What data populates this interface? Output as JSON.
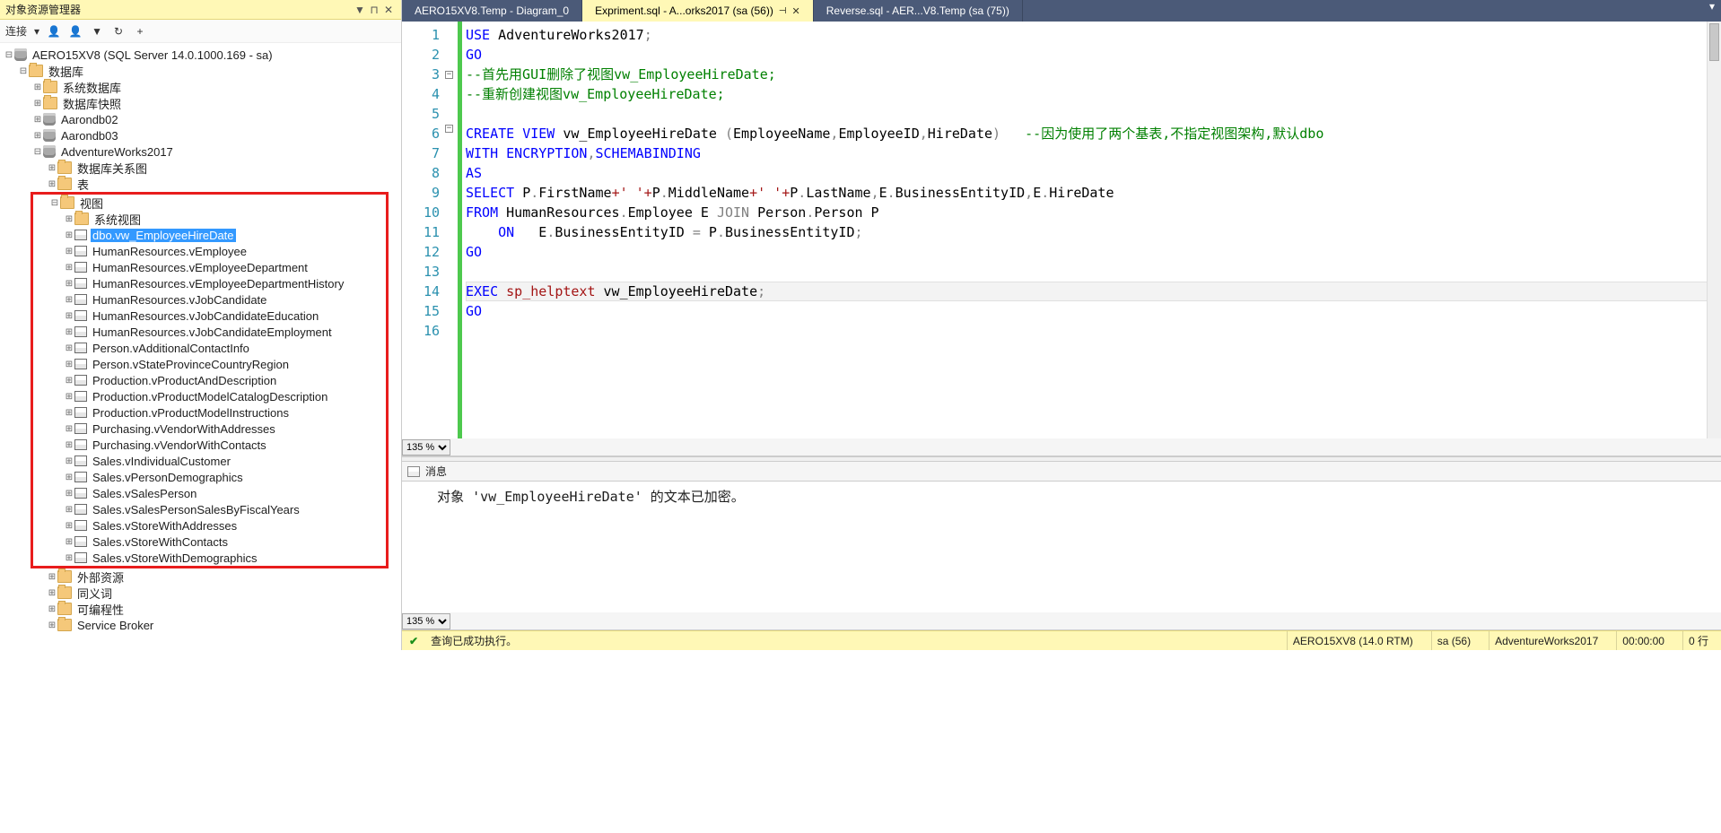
{
  "panel": {
    "title": "对象资源管理器",
    "connect_label": "连接",
    "dropdown_icon": "▼",
    "pin_icon": "⊓",
    "close_icon": "✕"
  },
  "toolbar_icons": {
    "connect_person": "👤",
    "disconnect_person": "👤",
    "filter": "▼",
    "refresh": "↻",
    "plus": "+"
  },
  "tree": {
    "root": "AERO15XV8 (SQL Server 14.0.1000.169 - sa)",
    "databases": "数据库",
    "sys_dbs": "系统数据库",
    "db_snapshots": "数据库快照",
    "db1": "Aarondb02",
    "db2": "Aarondb03",
    "adv": "AdventureWorks2017",
    "diagrams": "数据库关系图",
    "tables": "表",
    "views": "视图",
    "sys_views": "系统视图",
    "external": "外部资源",
    "synonyms": "同义词",
    "programmability": "可编程性",
    "service_broker": "Service Broker",
    "selected_view": "dbo.vw_EmployeeHireDate",
    "view_list": [
      "HumanResources.vEmployee",
      "HumanResources.vEmployeeDepartment",
      "HumanResources.vEmployeeDepartmentHistory",
      "HumanResources.vJobCandidate",
      "HumanResources.vJobCandidateEducation",
      "HumanResources.vJobCandidateEmployment",
      "Person.vAdditionalContactInfo",
      "Person.vStateProvinceCountryRegion",
      "Production.vProductAndDescription",
      "Production.vProductModelCatalogDescription",
      "Production.vProductModelInstructions",
      "Purchasing.vVendorWithAddresses",
      "Purchasing.vVendorWithContacts",
      "Sales.vIndividualCustomer",
      "Sales.vPersonDemographics",
      "Sales.vSalesPerson",
      "Sales.vSalesPersonSalesByFiscalYears",
      "Sales.vStoreWithAddresses",
      "Sales.vStoreWithContacts",
      "Sales.vStoreWithDemographics"
    ]
  },
  "tabs": {
    "t1": "AERO15XV8.Temp - Diagram_0",
    "t2": "Expriment.sql - A...orks2017 (sa (56))",
    "t3": "Reverse.sql - AER...V8.Temp (sa (75))"
  },
  "lines": [
    "1",
    "2",
    "3",
    "4",
    "5",
    "6",
    "7",
    "8",
    "9",
    "10",
    "11",
    "12",
    "13",
    "14",
    "15",
    "16"
  ],
  "code": {
    "l1_kw1": "USE",
    "l1_id": " AdventureWorks2017",
    "l1_sc": ";",
    "l2": "GO",
    "l3_cm": "--首先用GUI删除了视图vw_EmployeeHireDate;",
    "l4_cm": "--重新创建视图vw_EmployeeHireDate;",
    "l6_a": "CREATE",
    "l6_b": " VIEW",
    "l6_c": " vw_EmployeeHireDate ",
    "l6_d": "(",
    "l6_e": "EmployeeName",
    "l6_f": ",",
    "l6_g": "EmployeeID",
    "l6_h": ",",
    "l6_i": "HireDate",
    "l6_j": ")",
    "l6_cm": "   --因为使用了两个基表,不指定视图架构,默认dbo",
    "l7_a": "WITH",
    "l7_b": " ENCRYPTION",
    "l7_c": ",",
    "l7_d": "SCHEMABINDING",
    "l8": "AS",
    "l9_a": "SELECT",
    "l9_b": " P",
    "l9_c": ".",
    "l9_d": "FirstName",
    "l9_e": "+' '+",
    "l9_f": "P",
    "l9_g": ".",
    "l9_h": "MiddleName",
    "l9_i": "+' '+",
    "l9_j": "P",
    "l9_k": ".",
    "l9_l": "LastName",
    "l9_m": ",",
    "l9_n": "E",
    "l9_o": ".",
    "l9_p": "BusinessEntityID",
    "l9_q": ",",
    "l9_r": "E",
    "l9_s": ".",
    "l9_t": "HireDate",
    "l10_a": "FROM",
    "l10_b": " HumanResources",
    "l10_c": ".",
    "l10_d": "Employee E ",
    "l10_e": "JOIN",
    "l10_f": " Person",
    "l10_g": ".",
    "l10_h": "Person P",
    "l11_a": "ON",
    "l11_b": "   E",
    "l11_c": ".",
    "l11_d": "BusinessEntityID ",
    "l11_e": "=",
    "l11_f": " P",
    "l11_g": ".",
    "l11_h": "BusinessEntityID",
    "l11_i": ";",
    "l12": "GO",
    "l14_a": "EXEC",
    "l14_b": " sp_helptext",
    "l14_c": " vw_EmployeeHireDate",
    "l14_d": ";",
    "l15": "GO"
  },
  "zoom": "135 %",
  "messages": {
    "tab": "消息",
    "body": "   对象 'vw_EmployeeHireDate' 的文本已加密。"
  },
  "status": {
    "ok_icon": "✔",
    "ok_text": "查询已成功执行。",
    "server": "AERO15XV8 (14.0 RTM)",
    "user": "sa (56)",
    "db": "AdventureWorks2017",
    "time": "00:00:00",
    "rows": "0 行"
  }
}
